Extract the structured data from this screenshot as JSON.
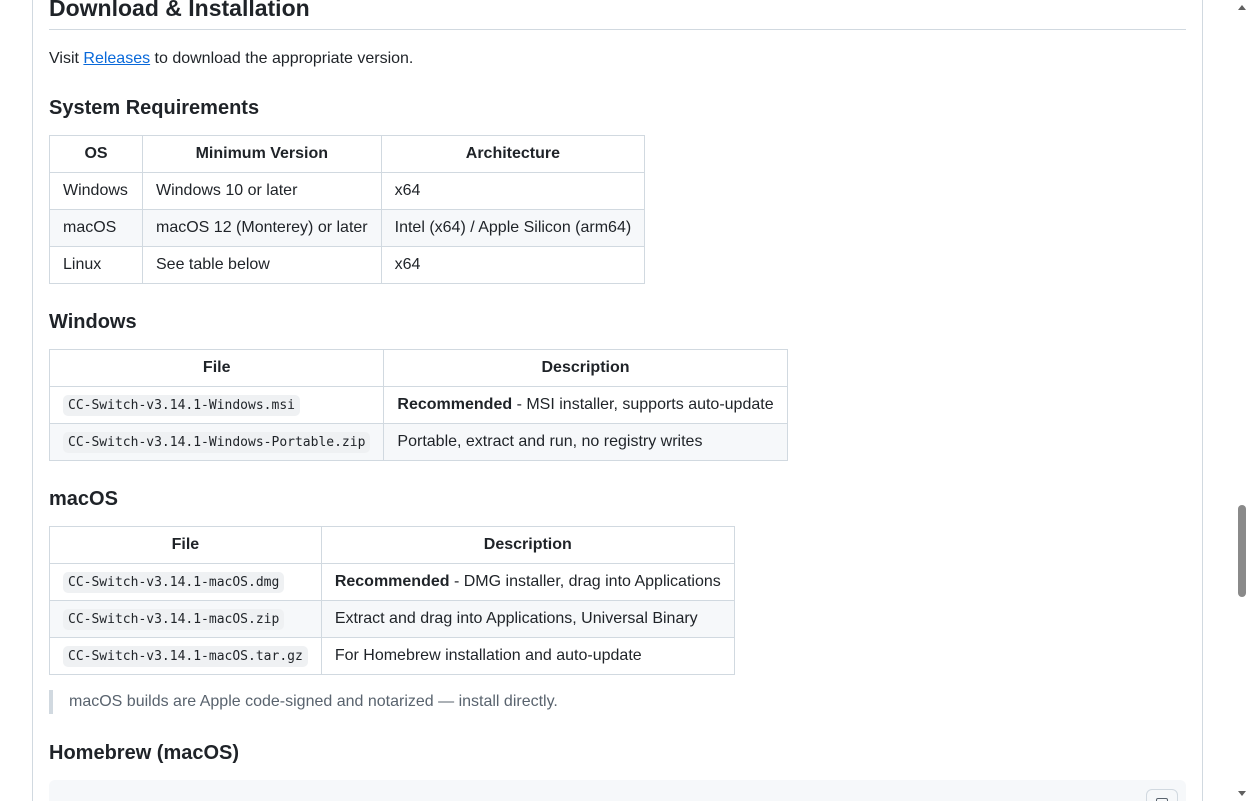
{
  "section": {
    "title": "Download & Installation",
    "intro_before": "Visit ",
    "intro_link": "Releases",
    "intro_after": " to download the appropriate version."
  },
  "system_requirements": {
    "heading": "System Requirements",
    "headers": [
      "OS",
      "Minimum Version",
      "Architecture"
    ],
    "rows": [
      [
        "Windows",
        "Windows 10 or later",
        "x64"
      ],
      [
        "macOS",
        "macOS 12 (Monterey) or later",
        "Intel (x64) / Apple Silicon (arm64)"
      ],
      [
        "Linux",
        "See table below",
        "x64"
      ]
    ]
  },
  "windows": {
    "heading": "Windows",
    "headers": [
      "File",
      "Description"
    ],
    "rows": [
      {
        "file": "CC-Switch-v3.14.1-Windows.msi",
        "bold": "Recommended",
        "desc": " - MSI installer, supports auto-update"
      },
      {
        "file": "CC-Switch-v3.14.1-Windows-Portable.zip",
        "bold": "",
        "desc": "Portable, extract and run, no registry writes"
      }
    ]
  },
  "macos": {
    "heading": "macOS",
    "headers": [
      "File",
      "Description"
    ],
    "rows": [
      {
        "file": "CC-Switch-v3.14.1-macOS.dmg",
        "bold": "Recommended",
        "desc": " - DMG installer, drag into Applications"
      },
      {
        "file": "CC-Switch-v3.14.1-macOS.zip",
        "bold": "",
        "desc": "Extract and drag into Applications, Universal Binary"
      },
      {
        "file": "CC-Switch-v3.14.1-macOS.tar.gz",
        "bold": "",
        "desc": "For Homebrew installation and auto-update"
      }
    ],
    "note": "macOS builds are Apple code-signed and notarized — install directly."
  },
  "homebrew": {
    "heading": "Homebrew (macOS)"
  }
}
